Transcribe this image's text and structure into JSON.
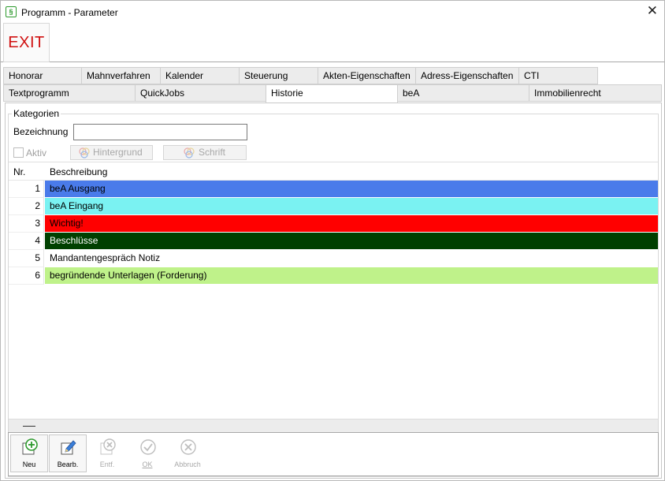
{
  "window": {
    "title": "Programm - Parameter",
    "app_icon": "§"
  },
  "toolbar": {
    "exit_label": "EXIT"
  },
  "tabs_row1": [
    {
      "label": "Honorar"
    },
    {
      "label": "Mahnverfahren"
    },
    {
      "label": "Kalender"
    },
    {
      "label": "Steuerung"
    },
    {
      "label": "Akten-Eigenschaften"
    },
    {
      "label": "Adress-Eigenschaften"
    },
    {
      "label": "CTI"
    }
  ],
  "tabs_row2": [
    {
      "label": "Textprogramm"
    },
    {
      "label": "QuickJobs"
    },
    {
      "label": "Historie",
      "active": true
    },
    {
      "label": "beA"
    },
    {
      "label": "Immobilienrecht"
    }
  ],
  "group": {
    "label": "Kategorien"
  },
  "form": {
    "bezeichnung_label": "Bezeichnung",
    "bezeichnung_value": "",
    "aktiv_label": "Aktiv",
    "hintergrund_label": "Hintergrund",
    "schrift_label": "Schrift"
  },
  "grid": {
    "headers": {
      "nr": "Nr.",
      "beschreibung": "Beschreibung"
    },
    "rows": [
      {
        "nr": "1",
        "beschreibung": "beA Ausgang",
        "bg": "#4a7bea",
        "fg": "#000000"
      },
      {
        "nr": "2",
        "beschreibung": "beA Eingang",
        "bg": "#7af2f2",
        "fg": "#000000"
      },
      {
        "nr": "3",
        "beschreibung": "Wichtig!",
        "bg": "#ff0000",
        "fg": "#000000"
      },
      {
        "nr": "4",
        "beschreibung": "Beschlüsse",
        "bg": "#004000",
        "fg": "#ffffff"
      },
      {
        "nr": "5",
        "beschreibung": "Mandantengespräch Notiz",
        "bg": "#ffffff",
        "fg": "#000000"
      },
      {
        "nr": "6",
        "beschreibung": "begründende Unterlagen (Forderung)",
        "bg": "#bff28a",
        "fg": "#000000"
      }
    ]
  },
  "bottom_buttons": {
    "neu": "Neu",
    "bearb": "Bearb.",
    "entf": "Entf.",
    "ok": "OK",
    "abbruch": "Abbruch"
  },
  "colors": {
    "accent_green": "#2e9a2e",
    "exit_red": "#d01010"
  }
}
